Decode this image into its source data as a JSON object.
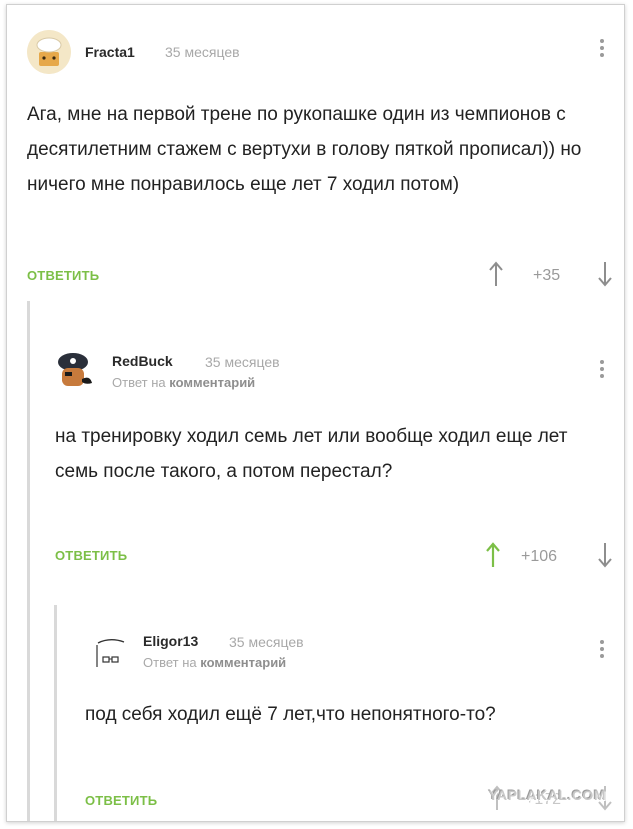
{
  "comments": [
    {
      "author": "Fracta1",
      "time": "35 месяцев",
      "text": "Ага, мне на первой трене по рукопашке один из чемпионов с десятилетним стажем с вертухи в голову пяткой прописал)) но ничего мне понравилось еще лет 7 ходил потом)",
      "reply_label": "ОТВЕТИТЬ",
      "score": "+35",
      "upvoted": false
    },
    {
      "author": "RedBuck",
      "time": "35 месяцев",
      "reply_to_prefix": "Ответ на",
      "reply_to_target": "комментарий",
      "text": "на тренировку ходил семь лет или вообще ходил еще лет семь после такого, а потом перестал?",
      "reply_label": "ОТВЕТИТЬ",
      "score": "+106",
      "upvoted": true
    },
    {
      "author": "Eligor13",
      "time": "35 месяцев",
      "reply_to_prefix": "Ответ на",
      "reply_to_target": "комментарий",
      "text": "под себя ходил ещё 7 лет,что непонятного-то?",
      "reply_label": "ОТВЕТИТЬ",
      "score": "+172",
      "upvoted": false
    }
  ],
  "watermark": "YAPLAKAL.COM",
  "colors": {
    "accent_green": "#7cbf47",
    "muted_gray": "#a8a8a8",
    "thread_line": "#d9d9d9"
  },
  "icons": [
    "avatar-chef",
    "avatar-pirate",
    "avatar-sketch",
    "kebab-menu-icon",
    "arrow-up-icon",
    "arrow-down-icon"
  ]
}
